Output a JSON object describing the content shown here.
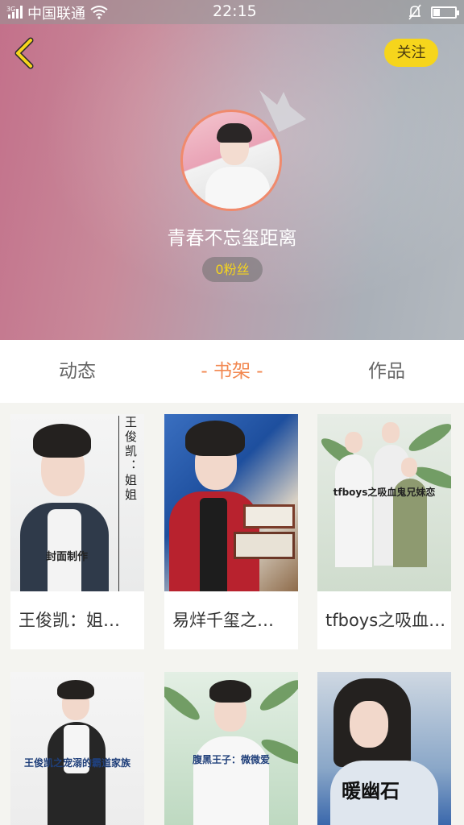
{
  "status_bar": {
    "signal_label": "3G",
    "carrier": "中国联通",
    "time": "22:15"
  },
  "header": {
    "follow_label": "关注",
    "username": "青春不忘玺距离",
    "fans_label": "0粉丝"
  },
  "tabs": [
    {
      "label": "动态",
      "active": false
    },
    {
      "label": "- 书架 -",
      "active": true
    },
    {
      "label": "作品",
      "active": false
    }
  ],
  "books": [
    {
      "title": "王俊凯：姐…",
      "cover_vertical_text": "王俊凯：姐姐",
      "cover_caption": "封面制作"
    },
    {
      "title": "易烊千玺之…"
    },
    {
      "title": "tfboys之吸血…",
      "cover_caption": "tfboys之吸血鬼兄妹恋"
    },
    {
      "title": "",
      "cover_caption": "王俊凯之宠溺的霸道家族"
    },
    {
      "title": "",
      "cover_caption": "腹黑王子：微微爱"
    },
    {
      "title": "",
      "cover_caption": "暖幽石"
    }
  ],
  "colors": {
    "accent": "#f2874f",
    "follow_button": "#f6d51c",
    "avatar_ring": "#f08a6c"
  }
}
